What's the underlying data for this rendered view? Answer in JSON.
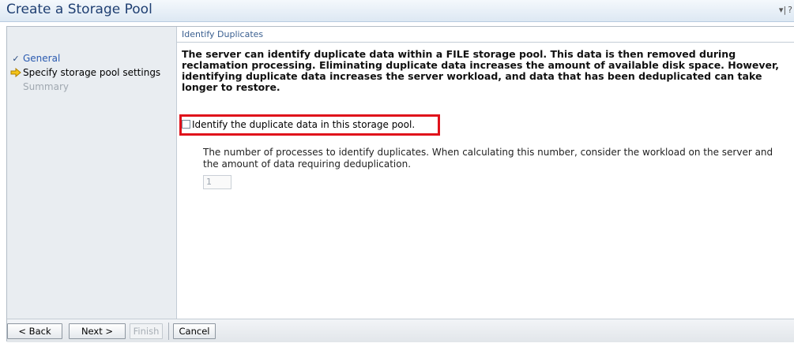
{
  "window": {
    "title": "Create a Storage Pool",
    "controls": [
      "minimize-icon",
      "help-icon"
    ]
  },
  "wizard": {
    "steps": [
      {
        "label": "General",
        "state": "done"
      },
      {
        "label": "Specify storage pool settings",
        "state": "current"
      },
      {
        "label": "Summary",
        "state": "future"
      }
    ]
  },
  "section": {
    "heading": "Identify Duplicates",
    "description": "The server can identify duplicate data within a FILE storage pool. This data is then removed during reclamation processing. Eliminating duplicate data increases the amount of available disk space. However, identifying duplicate data increases the server workload, and data that has been deduplicated can take longer to restore.",
    "checkbox_label": "Identify the duplicate data in this storage pool.",
    "checkbox_checked": false,
    "processes_note": "The number of processes to identify duplicates. When calculating this number, consider the workload on the server and the amount of data requiring deduplication.",
    "processes_value": "1",
    "processes_enabled": false
  },
  "buttons": {
    "back": "< Back",
    "next": "Next >",
    "finish": "Finish",
    "cancel": "Cancel"
  },
  "colors": {
    "title": "#1f3f72",
    "highlight": "#e0121b",
    "sidebar_bg": "#e9edf1",
    "step_done": "#2a5ab0",
    "step_future": "#a0a8b0",
    "arrow": "#f0b400"
  }
}
